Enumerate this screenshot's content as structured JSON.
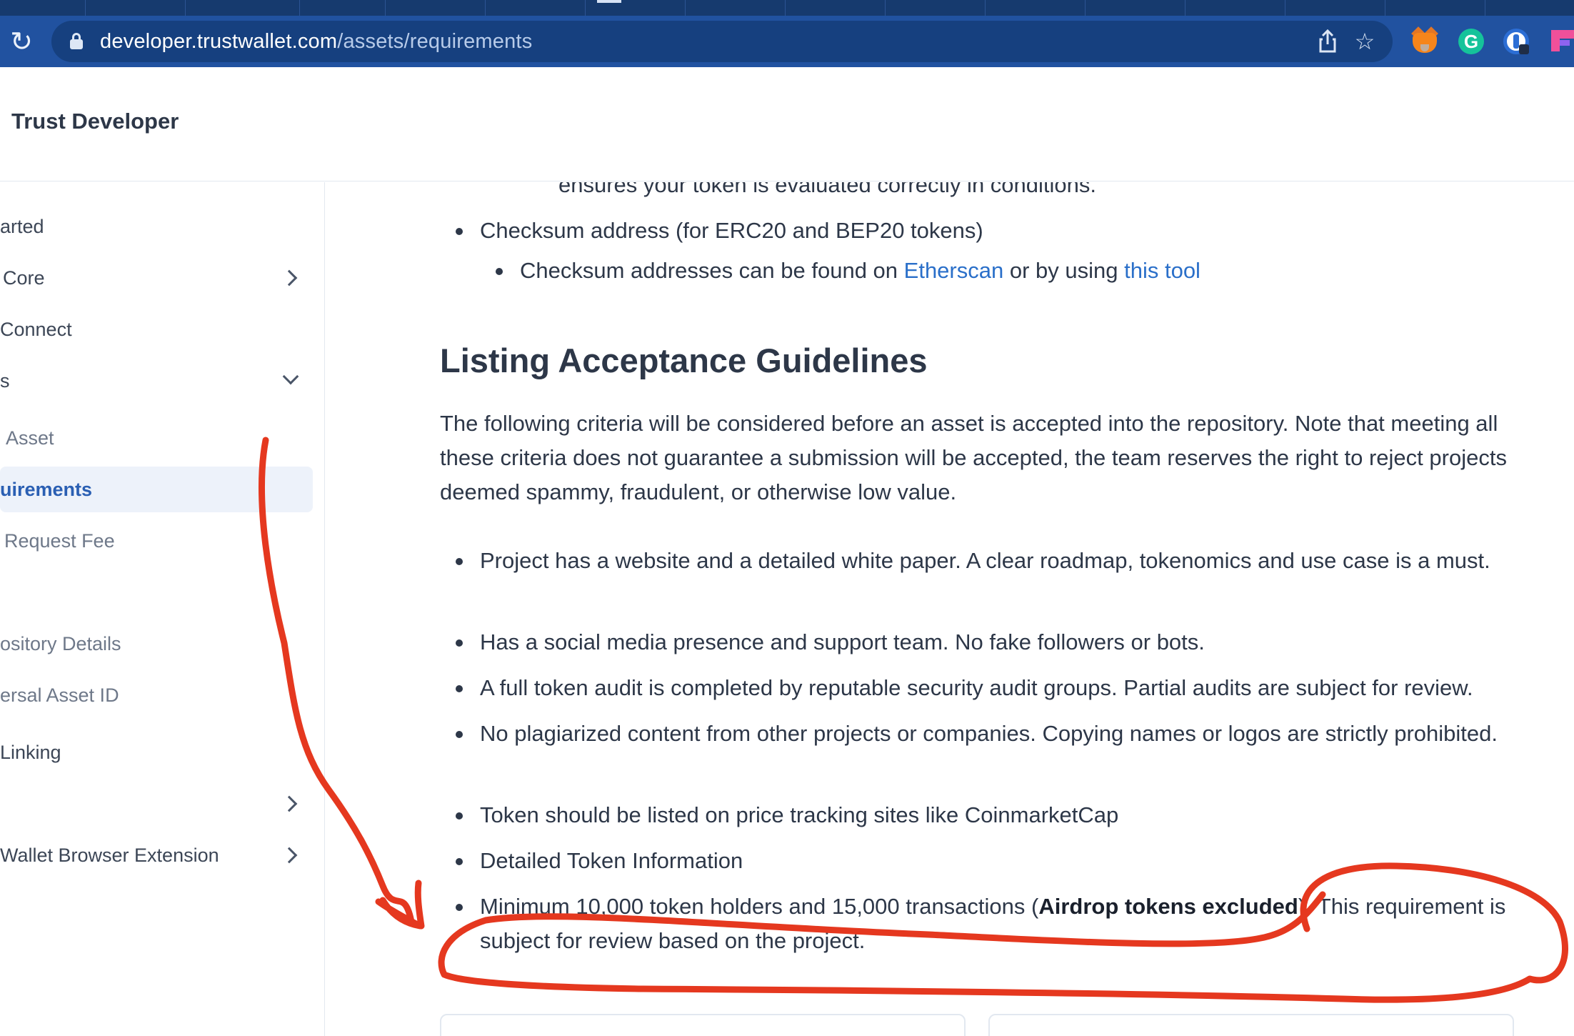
{
  "browser": {
    "url_host": "developer.trustwallet.com",
    "url_path": "/assets/requirements"
  },
  "site": {
    "title": "Trust Developer"
  },
  "sidebar": {
    "items": [
      {
        "label": "arted",
        "chevron": "none",
        "style": "top"
      },
      {
        "label": "Core",
        "chevron": "right",
        "style": "top"
      },
      {
        "label": "Connect",
        "chevron": "none",
        "style": "top"
      },
      {
        "label": "s",
        "chevron": "down",
        "style": "top"
      },
      {
        "label": "Asset",
        "chevron": "none",
        "style": "sub"
      },
      {
        "label": "uirements",
        "chevron": "none",
        "style": "active"
      },
      {
        "label": "Request Fee",
        "chevron": "none",
        "style": "sub"
      },
      {
        "label": "",
        "chevron": "none",
        "style": "sub"
      },
      {
        "label": "ository Details",
        "chevron": "none",
        "style": "sub"
      },
      {
        "label": "ersal Asset ID",
        "chevron": "none",
        "style": "sub"
      },
      {
        "label": "Linking",
        "chevron": "none",
        "style": "top"
      },
      {
        "label": "",
        "chevron": "right",
        "style": "top"
      },
      {
        "label": "Wallet Browser Extension",
        "chevron": "right",
        "style": "top"
      }
    ]
  },
  "content": {
    "cut_line": "ensures your token is evaluated correctly in conditions.",
    "checksum_item": "Checksum address (for ERC20 and BEP20 tokens)",
    "checksum_sub_prefix": "Checksum addresses can be found on ",
    "checksum_link_1": "Etherscan",
    "checksum_sub_middle": " or by using ",
    "checksum_link_2": "this tool",
    "section_title": "Listing Acceptance Guidelines",
    "intro": "The following criteria will be considered before an asset is accepted into the repository. Note that meeting all these criteria does not guarantee a submission will be accepted, the team reserves the right to reject projects deemed spammy, fraudulent, or otherwise low value.",
    "criteria": [
      "Project has a website and a detailed white paper. A clear roadmap, tokenomics and use case is a must.",
      "Has a social media presence and support team. No fake followers or bots.",
      "A full token audit is completed by reputable security audit groups. Partial audits are subject for review.",
      "No plagiarized content from other projects or companies. Copying names or logos are strictly prohibited.",
      "Token should be listed on price tracking sites like CoinmarketCap",
      "Detailed Token Information"
    ],
    "last_prefix": "Minimum 10,000 token holders and 15,000 transactions (",
    "last_bold": "Airdrop tokens excluded",
    "last_suffix": "). This requirement is subject for review based on the project."
  },
  "annotation": {
    "color": "#e5381f"
  }
}
